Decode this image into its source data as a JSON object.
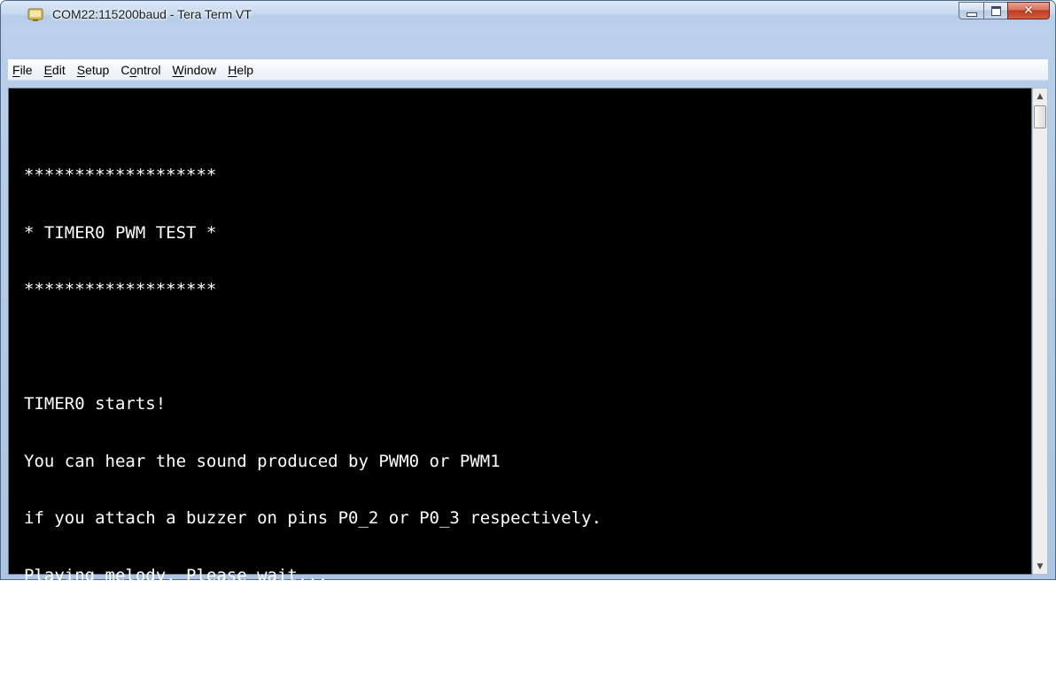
{
  "window": {
    "title": "COM22:115200baud - Tera Term VT",
    "icon": "tera-term-app-icon",
    "buttons": {
      "minimize": "minimize-icon",
      "maximize": "maximize-icon",
      "close": "close-icon"
    }
  },
  "menu": {
    "items": [
      {
        "label": "File",
        "accel": "F"
      },
      {
        "label": "Edit",
        "accel": "E"
      },
      {
        "label": "Setup",
        "accel": "S"
      },
      {
        "label": "Control",
        "accel": "o"
      },
      {
        "label": "Window",
        "accel": "W"
      },
      {
        "label": "Help",
        "accel": "H"
      }
    ]
  },
  "terminal": {
    "lines": [
      "*******************",
      "* TIMER0 PWM TEST *",
      "*******************",
      "",
      "TIMER0 starts!",
      "You can hear the sound produced by PWM0 or PWM1",
      "if you attach a buzzer on pins P0_2 or P0_3 respectively.",
      "Playing melody. Please wait...",
      "*****************"
    ],
    "colors": {
      "background": "#000000",
      "foreground": "#ffffff"
    }
  }
}
